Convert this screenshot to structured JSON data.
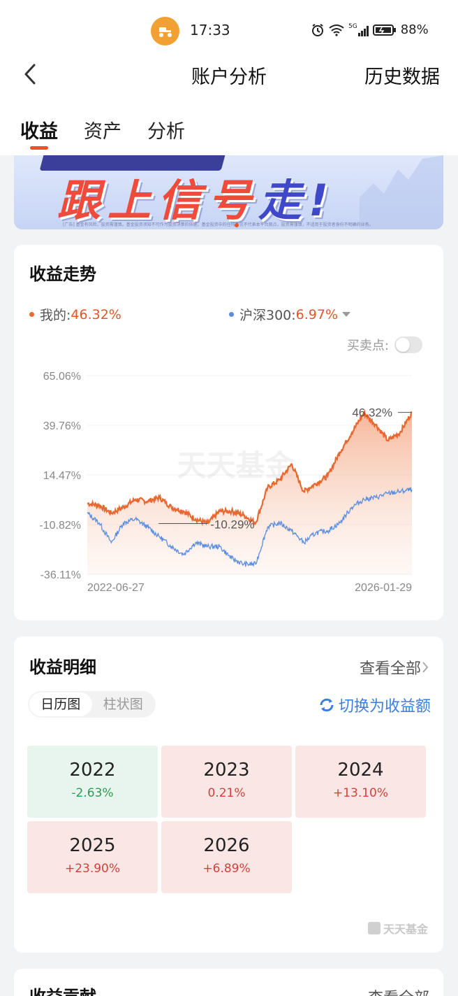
{
  "status_bar": {
    "time": "17:33",
    "network": "5G",
    "battery": "88%"
  },
  "nav": {
    "title": "账户分析",
    "right_link": "历史数据"
  },
  "tabs": [
    {
      "label": "收益",
      "active": true
    },
    {
      "label": "资产",
      "active": false
    },
    {
      "label": "分析",
      "active": false
    }
  ],
  "banner": {
    "headline_red": "跟上信号",
    "headline_blue": "走!",
    "fine_print": "[广告] 基金有风险，投资需谨慎。基金投资须知不可作为投资决策的依据，基金投资中的任何意见不代表本平台观点，投资需谨慎，不适用于投资者身份不明确的业务。"
  },
  "trend_card": {
    "title": "收益走势",
    "legend_mine_label": "我的:",
    "legend_mine_value": "46.32%",
    "legend_bench_label": "沪深300:",
    "legend_bench_value": "6.97%",
    "buy_sell_label": "买卖点:",
    "buy_sell_enabled": false,
    "watermark": "天天基金",
    "colors": {
      "mine": "#e8682f",
      "bench": "#5b8ee0"
    }
  },
  "chart_data": {
    "type": "line",
    "x_start": "2022-06-27",
    "x_end": "2026-01-29",
    "y_ticks": [
      "65.06%",
      "39.76%",
      "14.47%",
      "-10.82%",
      "-36.11%"
    ],
    "ylim": [
      -36.11,
      65.06
    ],
    "annotations": [
      {
        "text": "46.32%",
        "type": "max"
      },
      {
        "text": "-10.29%",
        "type": "min"
      }
    ],
    "series": [
      {
        "name": "我的",
        "x": [
          "2022-06-27",
          "2022-08",
          "2022-10",
          "2022-12",
          "2023-02",
          "2023-04",
          "2023-06",
          "2023-08",
          "2023-10",
          "2023-12",
          "2024-02",
          "2024-04",
          "2024-06",
          "2024-08",
          "2024-09-20",
          "2024-10",
          "2024-12",
          "2025-02",
          "2025-04",
          "2025-05",
          "2025-06",
          "2025-07",
          "2025-08",
          "2025-09",
          "2025-10",
          "2025-11",
          "2025-12",
          "2026-01-29"
        ],
        "values": [
          0,
          -1,
          -5,
          -2,
          2,
          1,
          3,
          -2,
          -4,
          -8,
          -10.29,
          -4,
          -4,
          -6,
          -10,
          8,
          12,
          20,
          6,
          10,
          14,
          26,
          36,
          46,
          40,
          32,
          36,
          46.32
        ]
      },
      {
        "name": "沪深300",
        "x": [
          "2022-06-27",
          "2022-08",
          "2022-10",
          "2022-12",
          "2023-02",
          "2023-04",
          "2023-06",
          "2023-08",
          "2023-10",
          "2023-12",
          "2024-02",
          "2024-04",
          "2024-06",
          "2024-08",
          "2024-09-20",
          "2024-10",
          "2024-12",
          "2025-02",
          "2025-04",
          "2025-05",
          "2025-06",
          "2025-07",
          "2025-08",
          "2025-09",
          "2025-10",
          "2025-11",
          "2025-12",
          "2026-01-29"
        ],
        "values": [
          -5,
          -10,
          -20,
          -10,
          -8,
          -12,
          -17,
          -22,
          -26,
          -20,
          -22,
          -22,
          -28,
          -31,
          -31,
          -12,
          -10,
          -14,
          -20,
          -15,
          -14,
          -10,
          -2,
          2,
          3,
          5,
          6,
          6.97
        ]
      }
    ]
  },
  "detail_card": {
    "title": "收益明细",
    "view_all": "查看全部",
    "segments": [
      "日历图",
      "柱状图"
    ],
    "active_segment": "日历图",
    "switch_label": "切换为收益额",
    "years": [
      {
        "year": "2022",
        "value": "-2.63%",
        "sign": "neg"
      },
      {
        "year": "2023",
        "value": "0.21%",
        "sign": "pos"
      },
      {
        "year": "2024",
        "value": "+13.10%",
        "sign": "pos"
      },
      {
        "year": "2025",
        "value": "+23.90%",
        "sign": "pos"
      },
      {
        "year": "2026",
        "value": "+6.89%",
        "sign": "pos"
      }
    ],
    "watermark": "天天基金"
  },
  "contrib_card": {
    "title": "收益贡献",
    "view_all": "查看全部"
  }
}
